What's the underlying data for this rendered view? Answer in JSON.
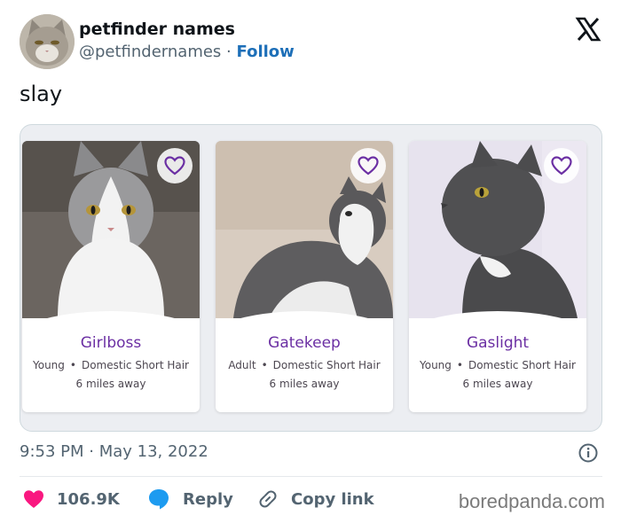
{
  "author": {
    "name": "petfinder names",
    "handle": "@petfindernames",
    "separator": "·",
    "follow_label": "Follow",
    "avatar_icon": "cat-avatar"
  },
  "platform_icon": "x-logo-icon",
  "tweet": {
    "text": "slay"
  },
  "pets": [
    {
      "name": "Girlboss",
      "age": "Young",
      "breed": "Domestic Short Hair",
      "distance": "6 miles away"
    },
    {
      "name": "Gatekeep",
      "age": "Adult",
      "breed": "Domestic Short Hair",
      "distance": "6 miles away"
    },
    {
      "name": "Gaslight",
      "age": "Young",
      "breed": "Domestic Short Hair",
      "distance": "6 miles away"
    }
  ],
  "meta_separator": "•",
  "timestamp": "9:53 PM · May 13, 2022",
  "actions": {
    "likes": "106.9K",
    "reply_label": "Reply",
    "copy_label": "Copy link"
  },
  "watermark": "boredpanda.com",
  "colors": {
    "accent_purple": "#6b2fa3",
    "like_pink": "#f91880",
    "reply_blue": "#1d9bf0",
    "follow_blue": "#1d6fb8"
  }
}
